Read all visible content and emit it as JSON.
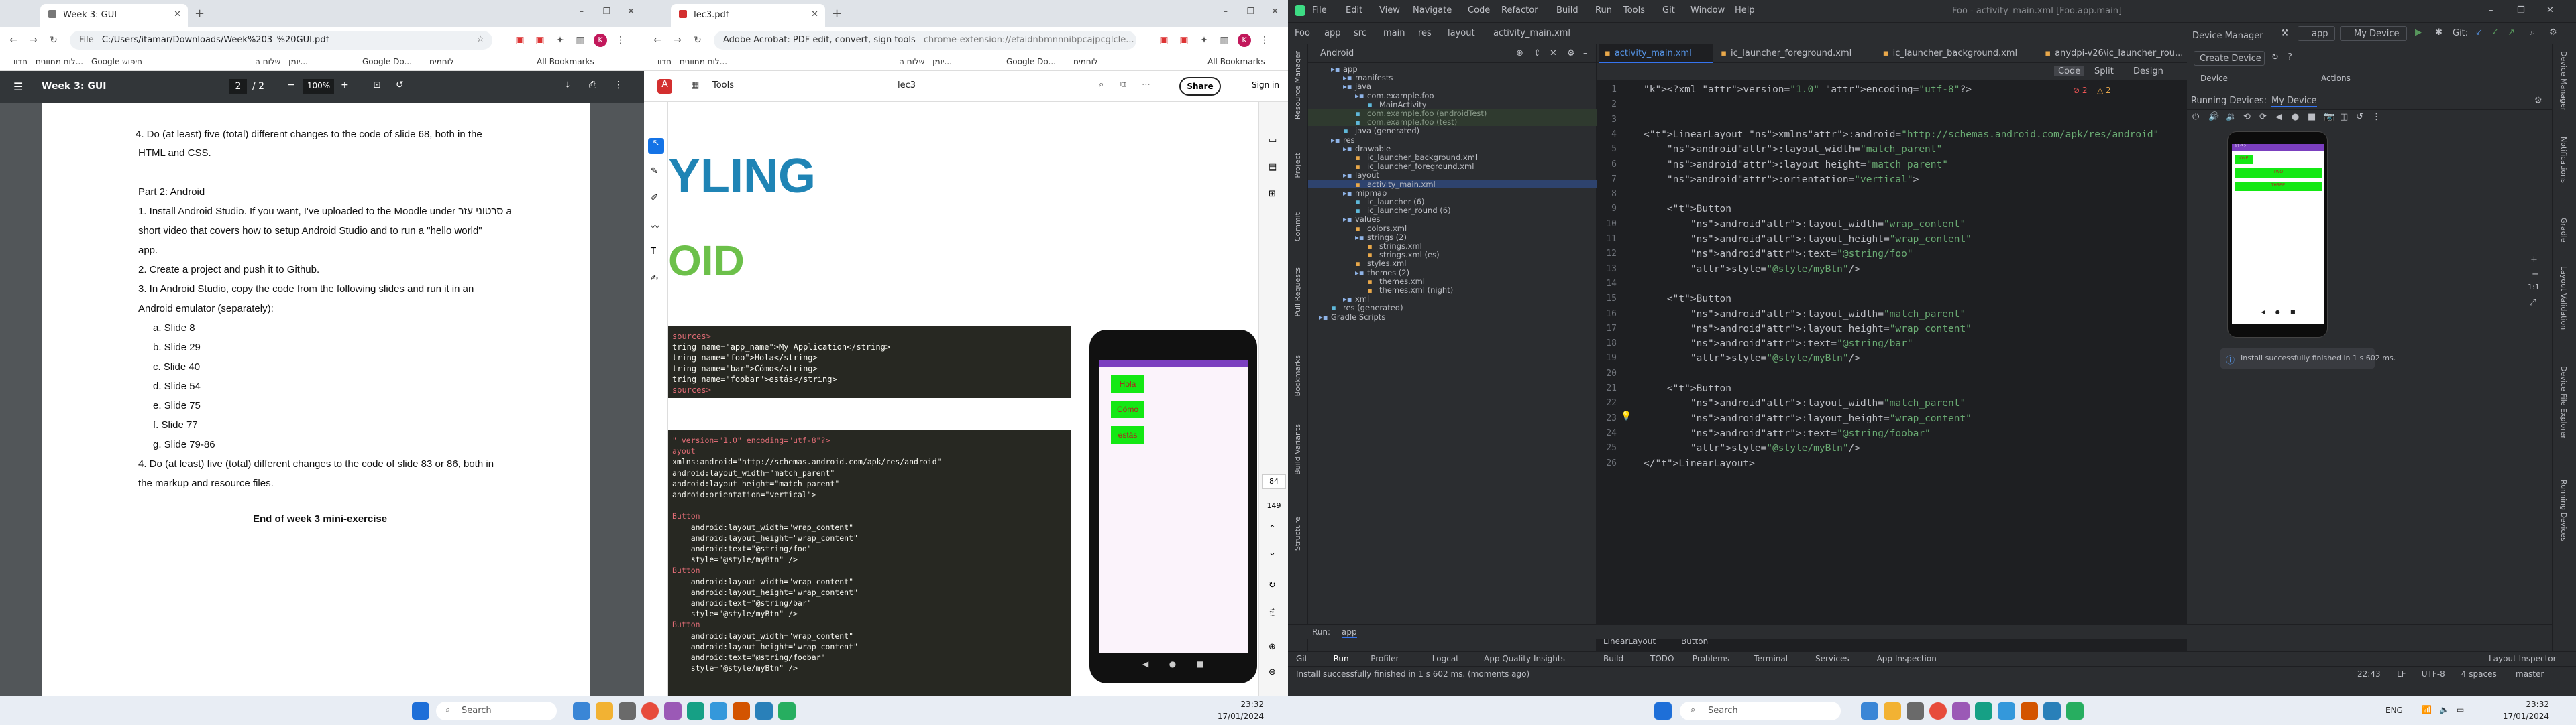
{
  "chrome_left": {
    "tab_title": "Week 3: GUI",
    "url_label": "File",
    "url": "C:/Users/itamar/Downloads/Week%203_%20GUI.pdf",
    "bookmarks": [
      "לוח מחוונים - חדוו... - Google חיפוש",
      "יומן - שלום ה...",
      "Google Do...",
      "לוחמים"
    ],
    "all_bookmarks": "All Bookmarks",
    "pdf_title": "Week 3: GUI",
    "page_current": "2",
    "page_total": "/ 2",
    "zoom": "100%",
    "doc_lines": [
      "4.   Do (at least) five (total) different changes to the code of slide 68, both in the",
      "HTML and CSS.",
      "Part 2: Android",
      "1.   Install Android Studio. If you want, I've uploaded to the Moodle under  סרטוני עזר  a",
      "short video that covers how to setup Android Studio and to run a \"hello world\"",
      "app.",
      "2.   Create a project and push it to Github.",
      "3.   In Android Studio, copy the code from the following slides and run it in an",
      "Android emulator (separately):",
      "a.   Slide 8",
      "b.   Slide 29",
      "c.   Slide 40",
      "d.   Slide 54",
      "e.   Slide 75",
      "f.    Slide 77",
      "g.   Slide 79-86",
      "4.   Do (at least) five (total) different changes to the code of slide 83 or 86, both in",
      "the markup and resource files.",
      "End of week 3 mini-exercise"
    ]
  },
  "chrome_right": {
    "tab_title": "lec3.pdf",
    "url_label": "Adobe Acrobat: PDF edit, convert, sign tools",
    "url": "chrome-extension://efaidnbmnnnibpcajpcglcle...",
    "bookmarks": [
      "לוח מחוונים - חדוו...",
      "יומן - שלום ה...",
      "Google Do...",
      "לוחמים"
    ],
    "all_bookmarks": "All Bookmarks",
    "tools": "Tools",
    "doc_name": "lec3",
    "share": "Share",
    "sign_in": "Sign in",
    "slide_big1": "YLING",
    "slide_big2": "OID",
    "page_num": "84",
    "page_total": "149",
    "code1": [
      "sources>",
      "tring name=\"app_name\">My Application</string>",
      "tring name=\"foo\">Hola</string>",
      "tring name=\"bar\">Cómo</string>",
      "tring name=\"foobar\">estás</string>",
      "sources>"
    ],
    "code2": [
      "\" version=\"1.0\" encoding=\"utf-8\"?>",
      "ayout",
      "xmlns:android=\"http://schemas.android.com/apk/res/android\"",
      "android:layout_width=\"match_parent\"",
      "android:layout_height=\"match_parent\"",
      "android:orientation=\"vertical\">",
      "",
      "Button",
      "    android:layout_width=\"wrap_content\"",
      "    android:layout_height=\"wrap_content\"",
      "    android:text=\"@string/foo\"",
      "    style=\"@style/myBtn\" />",
      "Button",
      "    android:layout_width=\"wrap_content\"",
      "    android:layout_height=\"wrap_content\"",
      "    android:text=\"@string/bar\"",
      "    style=\"@style/myBtn\" />",
      "Button",
      "    android:layout_width=\"wrap_content\"",
      "    android:layout_height=\"wrap_content\"",
      "    android:text=\"@string/foobar\"",
      "    style=\"@style/myBtn\" />"
    ],
    "phone_btns": [
      "Hola",
      "Cómo",
      "estás"
    ]
  },
  "taskbar_left": {
    "search": "Search",
    "time": "23:32",
    "date": "17/01/2024"
  },
  "taskbar_right": {
    "search": "Search",
    "lang": "ENG",
    "time": "23:32",
    "date": "17/01/2024"
  },
  "ide": {
    "menu": [
      "File",
      "Edit",
      "View",
      "Navigate",
      "Code",
      "Refactor",
      "Build",
      "Run",
      "Tools",
      "Git",
      "Window",
      "Help"
    ],
    "window_title": "Foo - activity_main.xml [Foo.app.main]",
    "breadcrumb": [
      "Foo",
      "app",
      "src",
      "main",
      "res",
      "layout",
      "activity_main.xml"
    ],
    "run_config": "app",
    "device": "My Device",
    "git_label": "Git:",
    "project_view": "Android",
    "editor_tabs": [
      "activity_main.xml",
      "ic_launcher_foreground.xml",
      "ic_launcher_background.xml",
      "anydpi-v26\\ic_launcher_rou..."
    ],
    "view_modes": [
      "Code",
      "Split",
      "Design"
    ],
    "tree": [
      "app",
      "manifests",
      "java",
      "com.example.foo",
      "MainActivity",
      "com.example.foo (androidTest)",
      "com.example.foo (test)",
      "java (generated)",
      "res",
      "drawable",
      "ic_launcher_background.xml",
      "ic_launcher_foreground.xml",
      "layout",
      "activity_main.xml",
      "mipmap",
      "ic_launcher (6)",
      "ic_launcher_round (6)",
      "values",
      "colors.xml",
      "strings (2)",
      "strings.xml",
      "strings.xml (es)",
      "styles.xml",
      "themes (2)",
      "themes.xml",
      "themes.xml (night)",
      "xml",
      "res (generated)",
      "Gradle Scripts"
    ],
    "inspection": "2",
    "inspection2": "2",
    "code_lines": [
      "<?xml version=\"1.0\" encoding=\"utf-8\"?>",
      "",
      "",
      "<LinearLayout xmlns:android=\"http://schemas.android.com/apk/res/android\"",
      "    android:layout_width=\"match_parent\"",
      "    android:layout_height=\"match_parent\"",
      "    android:orientation=\"vertical\">",
      "",
      "    <Button",
      "        android:layout_width=\"wrap_content\"",
      "        android:layout_height=\"wrap_content\"",
      "        android:text=\"@string/foo\"",
      "        style=\"@style/myBtn\"/>",
      "",
      "    <Button",
      "        android:layout_width=\"match_parent\"",
      "        android:layout_height=\"wrap_content\"",
      "        android:text=\"@string/bar\"",
      "        style=\"@style/myBtn\"/>",
      "",
      "    <Button",
      "        android:layout_width=\"match_parent\"",
      "        android:layout_height=\"wrap_content\"",
      "        android:text=\"@string/foobar\"",
      "        style=\"@style/myBtn\"/>",
      "</LinearLayout>"
    ],
    "editor_crumbs": [
      "LinearLayout",
      "Button"
    ],
    "device_manager": "Device Manager",
    "create_device": "Create Device",
    "device_col": "Device",
    "actions_col": "Actions",
    "running_devices": "Running Devices:",
    "running_device_tab": "My Device",
    "emu_buttons": [
      "ONE",
      "TWO",
      "THREE"
    ],
    "emu_time": "11:32",
    "scale": "1:1",
    "install_toast": "Install successfully finished in 1 s 602 ms.",
    "run_label": "Run:",
    "run_tab": "app",
    "bottom_tabs": [
      "Git",
      "Run",
      "Profiler",
      "Logcat",
      "App Quality Insights",
      "Build",
      "TODO",
      "Problems",
      "Terminal",
      "Services",
      "App Inspection"
    ],
    "layout_inspector": "Layout Inspector",
    "status": "Install successfully finished in 1 s 602 ms. (moments ago)",
    "status_right": [
      "22:43",
      "LF",
      "UTF-8",
      "4 spaces",
      "master"
    ],
    "left_strip": [
      "Resource Manager",
      "Project",
      "Commit",
      "Pull Requests",
      "Bookmarks",
      "Build Variants",
      "Structure"
    ],
    "right_strip": [
      "Device Manager",
      "Notifications",
      "Gradle",
      "Layout Validation",
      "Device File Explorer",
      "Running Devices"
    ]
  }
}
